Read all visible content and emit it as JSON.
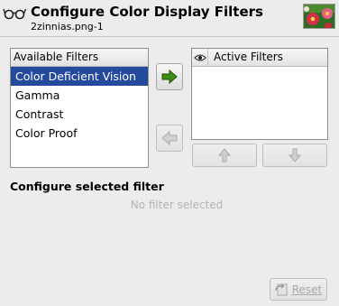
{
  "header": {
    "title": "Configure Color Display Filters",
    "subtitle": "2zinnias.png-1",
    "icon": "glasses-icon",
    "thumbnail": "zinnias-thumbnail"
  },
  "available": {
    "header": "Available Filters",
    "items": [
      {
        "label": "Color Deficient Vision",
        "selected": true
      },
      {
        "label": "Gamma",
        "selected": false
      },
      {
        "label": "Contrast",
        "selected": false
      },
      {
        "label": "Color Proof",
        "selected": false
      }
    ]
  },
  "active": {
    "header": "Active Filters",
    "header_icon": "eye-icon",
    "items": []
  },
  "buttons": {
    "add": {
      "icon": "arrow-right-icon",
      "enabled": true
    },
    "remove": {
      "icon": "arrow-left-icon",
      "enabled": false
    },
    "up": {
      "icon": "arrow-up-icon",
      "enabled": false
    },
    "down": {
      "icon": "arrow-down-icon",
      "enabled": false
    },
    "reset": {
      "label": "Reset",
      "icon": "reset-icon",
      "enabled": false
    }
  },
  "config": {
    "title": "Configure selected filter",
    "placeholder": "No filter selected"
  },
  "colors": {
    "selection": "#244a9c",
    "add_arrow": "#3f8f17",
    "disabled_text": "#a8a8a8"
  }
}
